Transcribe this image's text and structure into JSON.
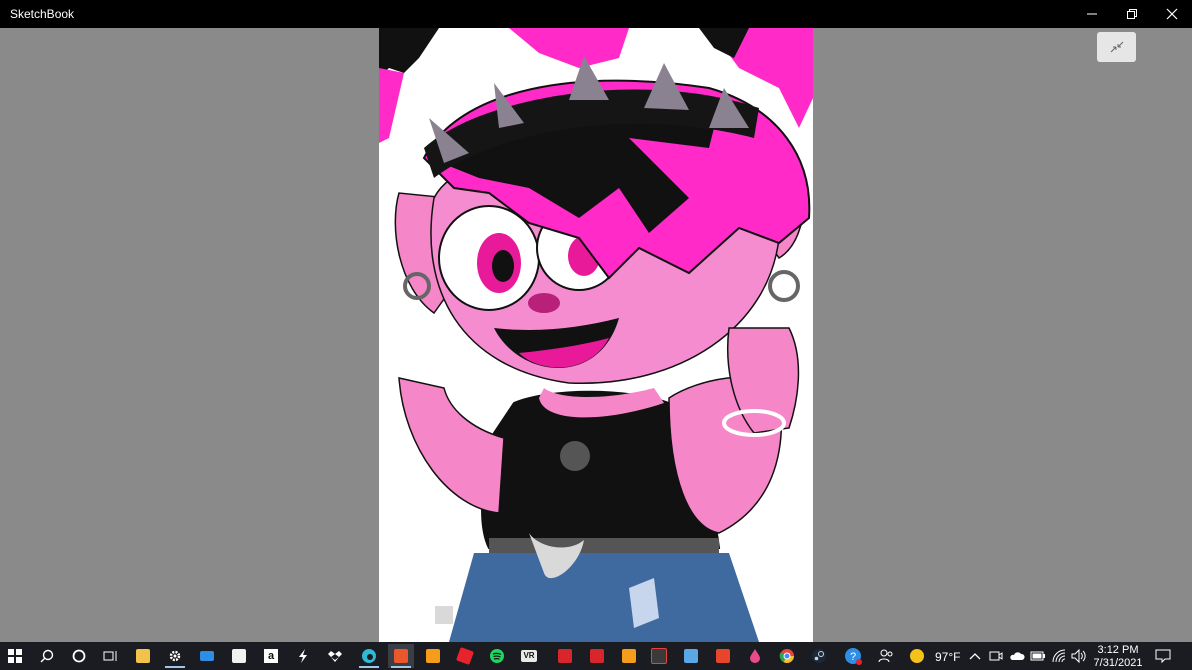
{
  "window": {
    "title": "SketchBook"
  },
  "taskbar": {
    "apps": [
      {
        "name": "file-explorer",
        "color": "#f3c24a"
      },
      {
        "name": "settings",
        "color": "#ffffff"
      },
      {
        "name": "mail",
        "color": "#2e8ee6"
      },
      {
        "name": "store",
        "color": "#f2f2f2"
      },
      {
        "name": "amazon",
        "color": "#ffffff"
      },
      {
        "name": "app-s",
        "color": "#ffffff"
      },
      {
        "name": "dropbox",
        "color": "#ffffff"
      },
      {
        "name": "edge",
        "color": "#2fb9d6"
      },
      {
        "name": "sketchbook",
        "color": "#e8582c"
      },
      {
        "name": "app-orange",
        "color": "#f59c1a"
      },
      {
        "name": "app-red",
        "color": "#e8232c"
      },
      {
        "name": "spotify",
        "color": "#1ed760"
      },
      {
        "name": "vr",
        "color": "#e9e9e9"
      },
      {
        "name": "flash-1",
        "color": "#d8262c"
      },
      {
        "name": "flash-2",
        "color": "#d8262c"
      },
      {
        "name": "app-game",
        "color": "#f59c1a"
      },
      {
        "name": "app-badge",
        "color": "#3a3a3a"
      },
      {
        "name": "photos",
        "color": "#5aa9e6"
      },
      {
        "name": "office",
        "color": "#e8462c"
      },
      {
        "name": "drop-app",
        "color": "#e84a8a"
      },
      {
        "name": "chrome",
        "color": "#f2c029"
      },
      {
        "name": "steam",
        "color": "#c5d4e3"
      }
    ],
    "amazon_glyph": "a",
    "vr_glyph": "VR",
    "weather": {
      "temp": "97°F"
    },
    "clock": {
      "time": "3:12 PM",
      "date": "7/31/2021"
    }
  }
}
